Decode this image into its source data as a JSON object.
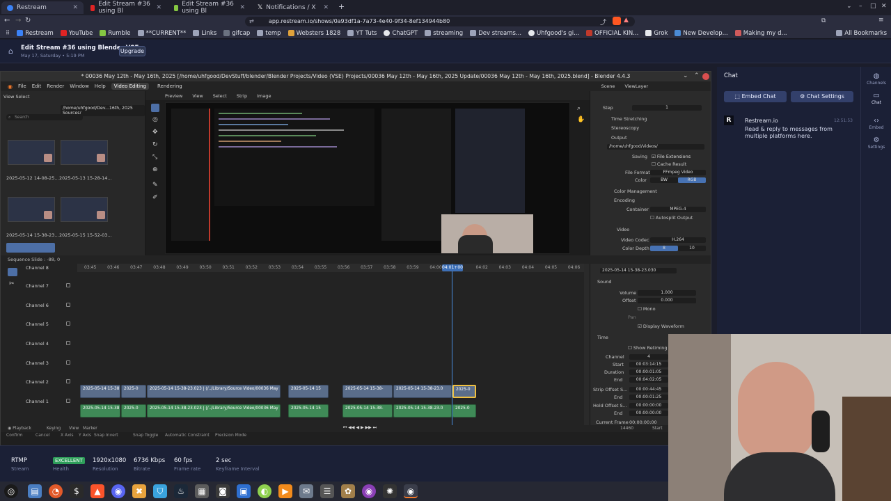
{
  "browser": {
    "tabs": [
      {
        "title": "Restream",
        "active": true
      },
      {
        "title": "Edit Stream #36 using Bl"
      },
      {
        "title": "Edit Stream #36 using Bl"
      },
      {
        "title": "Notifications / X"
      }
    ],
    "url": "app.restream.io/shows/0a93df1a-7a73-4e40-9f34-8ef134944b80",
    "bookmarks": [
      "Restream",
      "YouTube",
      "Rumble",
      "**CURRENT**",
      "Links",
      "gifcap",
      "temp",
      "Websters 1828",
      "YT Tuts",
      "ChatGPT",
      "streaming",
      "Dev streams...",
      "Uhfgood's gi...",
      "OFFICIAL KIN...",
      "Grok",
      "New Develop...",
      "Making my d..."
    ],
    "all_bookmarks": "All Bookmarks"
  },
  "restream": {
    "title": "Edit Stream #36 using Blender VSE.",
    "date": "May 17, Saturday • 5:19 PM",
    "upgrade": "Upgrade"
  },
  "blender": {
    "title": "* 00036 May 12th - May 16th, 2025 [/home/uhfgood/DevStuff/blender/Blender Projects/Video (VSE) Projects/00036 May 12th - May 16th, 2025 Update/00036 May 12th - May 16th, 2025.blend] - Blender 4.4.3",
    "menu": [
      "File",
      "Edit",
      "Render",
      "Window",
      "Help"
    ],
    "workspaces": [
      "Video Editing",
      "Rendering"
    ],
    "file_path": "/home/uhfgood/Dev...16th, 2025 Sources/",
    "search_placeholder": "Search",
    "thumbs": [
      "2025-05-12 14-08-25...",
      "2025-05-13 15-28-14...",
      "2025-05-14 15-38-23...",
      "2025-05-15 15-52-03..."
    ],
    "preview_header": [
      "Preview",
      "View",
      "Select",
      "Strip",
      "Image"
    ],
    "scene": "Scene",
    "viewlayer": "ViewLayer",
    "props": {
      "step_label": "Step",
      "step_value": "1",
      "time_stretching": "Time Stretching",
      "stereoscopy": "Stereoscopy",
      "output": "Output",
      "output_path": "/home/uhfgood/Videos/",
      "saving": "Saving",
      "file_extensions": "File Extensions",
      "cache_result": "Cache Result",
      "file_format_label": "File Format",
      "file_format": "FFmpeg Video",
      "color_label": "Color",
      "bw": "BW",
      "rgb": "RGB",
      "color_management": "Color Management",
      "encoding": "Encoding",
      "container_label": "Container",
      "container": "MPEG-4",
      "autosplit": "Autosplit Output",
      "video": "Video",
      "codec_label": "Video Codec",
      "codec": "H.264",
      "depth_label": "Color Depth",
      "depth_8": "8",
      "depth_10": "10"
    },
    "sequence_header": "Sequence Slide : -88, 0",
    "ruler": [
      "03:45",
      "03:46",
      "03:47",
      "03:48",
      "03:49",
      "03:50",
      "03:51",
      "03:52",
      "03:53",
      "03:54",
      "03:55",
      "03:56",
      "03:57",
      "03:58",
      "03:59",
      "04:00",
      "04:01+00",
      "04:02",
      "04:03",
      "04:04",
      "04:05",
      "04:06"
    ],
    "playhead": "04:01+00",
    "channels": [
      "Channel 8",
      "Channel 7",
      "Channel 6",
      "Channel 5",
      "Channel 4",
      "Channel 3",
      "Channel 2",
      "Channel 1"
    ],
    "strips": {
      "v1": "2025-05-14 15-38",
      "v2": "2025-0",
      "v3": "2025-05-14 15-38-23.023 | (/../Library/Source Video/00036 May",
      "v4": "2025-05-14 15",
      "v5": "2025-05-14 15-38-",
      "v6": "2025-05-14 15-38-23.0",
      "v7": "2025-0"
    },
    "side": {
      "file": "2025-05-14 15-38-23.030",
      "sound": "Sound",
      "volume_label": "Volume",
      "volume": "1.000",
      "offset_label": "Offset",
      "offset": "0.000",
      "mono": "Mono",
      "pan": "Pan",
      "display_waveform": "Display Waveform",
      "time": "Time",
      "show_retiming": "Show Retiming Keys",
      "channel_label": "Channel",
      "channel": "4",
      "start_label": "Start",
      "start": "00:03:14:15",
      "duration_label": "Duration",
      "duration": "00:00:01:05",
      "end_label": "End",
      "end": "00:04:02:05",
      "strip_offset_label": "Strip Offset S...",
      "strip_offset": "00:00:44:45",
      "end2_label": "End",
      "end2": "00:00:01:25",
      "hold_offset_label": "Hold Offset S...",
      "hold_offset": "00:00:00:00",
      "end3_label": "End",
      "end3": "00:00:00:00",
      "current_frame_label": "Current Frame",
      "current_frame": "00:00:00:00"
    },
    "footer": [
      "Playback",
      "Keying",
      "View",
      "Marker"
    ],
    "frame": "14460",
    "start": "Start",
    "status": [
      "Confirm",
      "Cancel",
      "X Axis",
      "Y Axis",
      "Snap Invert",
      "Snap Toggle",
      "Automatic Constraint",
      "Precision Mode"
    ]
  },
  "chat": {
    "title": "Chat",
    "embed": "Embed Chat",
    "settings": "Chat Settings",
    "bot_name": "Restream.io",
    "bot_time": "12:51:53",
    "bot_message": "Read & reply to messages from multiple platforms here.",
    "side": [
      "Channels",
      "Chat",
      "Embed",
      "Settings"
    ]
  },
  "stats": [
    {
      "value": "RTMP",
      "label": "Stream"
    },
    {
      "value": "EXCELLENT",
      "label": "Health"
    },
    {
      "value": "1920x1080",
      "label": "Resolution"
    },
    {
      "value": "6736 Kbps",
      "label": "Bitrate"
    },
    {
      "value": "60 fps",
      "label": "Frame rate"
    },
    {
      "value": "2 sec",
      "label": "Keyframe Interval"
    }
  ],
  "colors": {
    "restream_bg": "#1b2036",
    "chat_button": "#33406b",
    "health_green": "#2e9e5a",
    "audio_strip": "#3f8a57",
    "video_strip": "#5a6d8a",
    "selection": "#f0c040",
    "playhead": "#4a90e2"
  }
}
